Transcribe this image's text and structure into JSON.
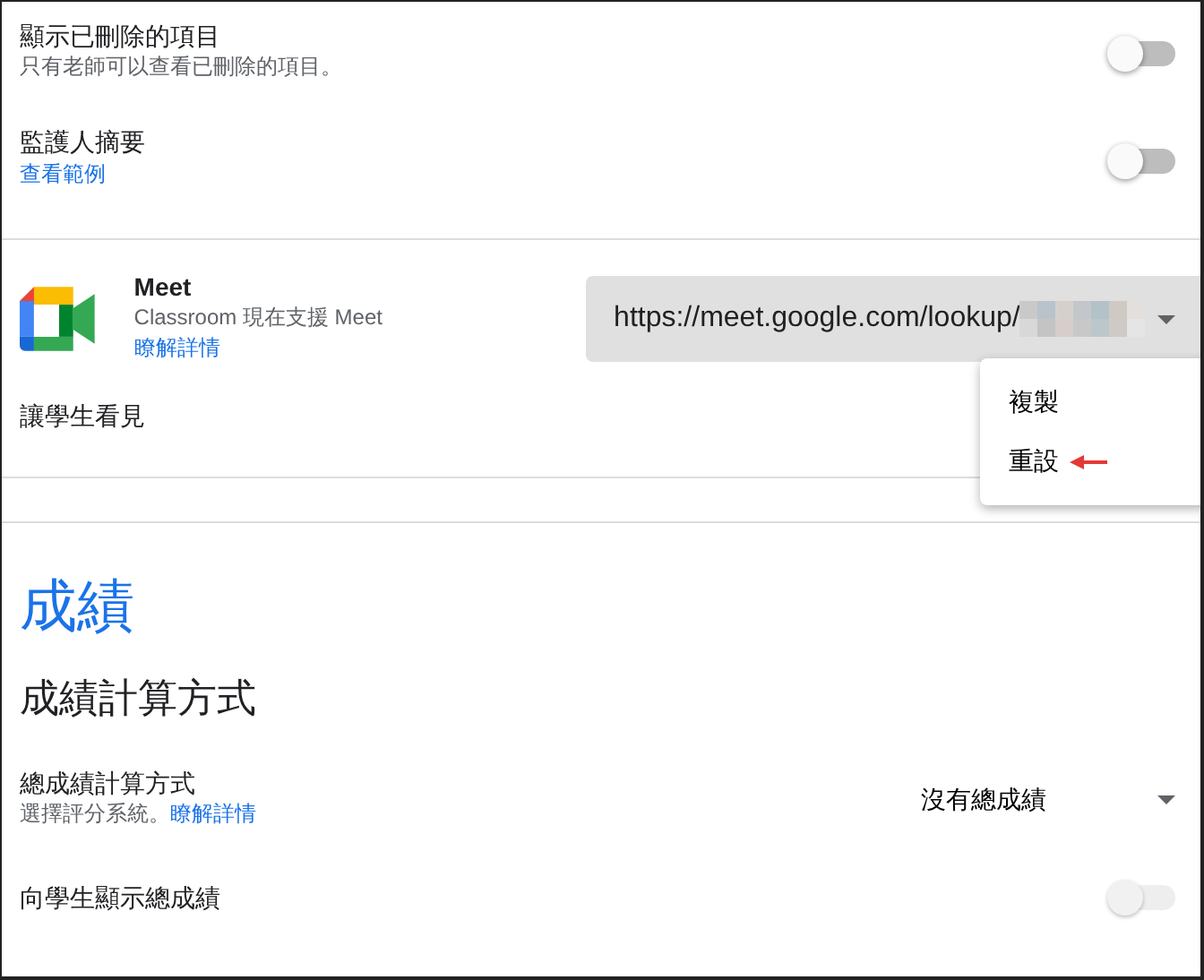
{
  "settings": [
    {
      "title": "顯示已刪除的項目",
      "description": "只有老師可以查看已刪除的項目。",
      "on": false,
      "disabled": false
    },
    {
      "title": "監護人摘要",
      "link": "查看範例",
      "on": false,
      "disabled": false
    }
  ],
  "meet": {
    "name": "Meet",
    "description": "Classroom 現在支援 Meet",
    "link": "瞭解詳情",
    "url": "https://meet.google.com/lookup/",
    "visibility_label": "讓學生看見"
  },
  "menu": {
    "items": [
      {
        "label": "複製",
        "pointed": false
      },
      {
        "label": "重設",
        "pointed": true
      }
    ]
  },
  "grades": {
    "heading": "成績",
    "subheading": "成績計算方式",
    "calculation": {
      "title": "總成績計算方式",
      "description": "選擇評分系統。",
      "link": "瞭解詳情",
      "value": "沒有總成績"
    },
    "show_overall": {
      "title": "向學生顯示總成績",
      "on": false,
      "disabled": true
    }
  }
}
